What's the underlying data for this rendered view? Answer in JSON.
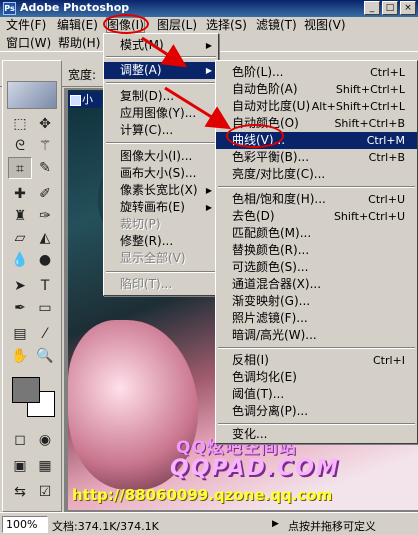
{
  "window": {
    "title": "Adobe Photoshop",
    "buttons": [
      "_",
      "□",
      "×"
    ]
  },
  "menubar": {
    "row1": [
      "文件(F)",
      "编辑(E)",
      "图像(I)",
      "图层(L)",
      "选择(S)",
      "滤镜(T)",
      "视图(V)"
    ],
    "row2": [
      "窗口(W)",
      "帮助(H)"
    ]
  },
  "options": {
    "width_label": "宽度:"
  },
  "document": {
    "tab_title": "小"
  },
  "image_menu": {
    "items": [
      {
        "label": "模式(M)",
        "submenu": true
      },
      {
        "label": "调整(A)",
        "submenu": true
      },
      {
        "label": "复制(D)..."
      },
      {
        "label": "应用图像(Y)..."
      },
      {
        "label": "计算(C)..."
      },
      {
        "label": "图像大小(I)..."
      },
      {
        "label": "画布大小(S)..."
      },
      {
        "label": "像素长宽比(X)",
        "submenu": true
      },
      {
        "label": "旋转画布(E)",
        "submenu": true
      },
      {
        "label": "裁切(P)",
        "disabled": true
      },
      {
        "label": "修整(R)..."
      },
      {
        "label": "显示全部(V)",
        "disabled": true
      },
      {
        "label": "陷印(T)...",
        "disabled": true
      }
    ]
  },
  "adjust_menu": {
    "items": [
      {
        "label": "色阶(L)...",
        "shortcut": "Ctrl+L"
      },
      {
        "label": "自动色阶(A)",
        "shortcut": "Shift+Ctrl+L"
      },
      {
        "label": "自动对比度(U)",
        "shortcut": "Alt+Shift+Ctrl+L"
      },
      {
        "label": "自动颜色(O)",
        "shortcut": "Shift+Ctrl+B"
      },
      {
        "label": "曲线(V)...",
        "shortcut": "Ctrl+M"
      },
      {
        "label": "色彩平衡(B)...",
        "shortcut": "Ctrl+B"
      },
      {
        "label": "亮度/对比度(C)..."
      },
      {
        "label": "色相/饱和度(H)...",
        "shortcut": "Ctrl+U"
      },
      {
        "label": "去色(D)",
        "shortcut": "Shift+Ctrl+U"
      },
      {
        "label": "匹配颜色(M)..."
      },
      {
        "label": "替换颜色(R)..."
      },
      {
        "label": "可选颜色(S)..."
      },
      {
        "label": "通道混合器(X)..."
      },
      {
        "label": "渐变映射(G)..."
      },
      {
        "label": "照片滤镜(F)..."
      },
      {
        "label": "暗调/高光(W)..."
      },
      {
        "label": "反相(I)",
        "shortcut": "Ctrl+I"
      },
      {
        "label": "色调均化(E)"
      },
      {
        "label": "阈值(T)..."
      },
      {
        "label": "色调分离(P)..."
      },
      {
        "label": "变化..."
      }
    ]
  },
  "watermark": {
    "line1": "QQ炫吧空间站",
    "line2": "QQPAD.COM",
    "line3": "http://88060099.qzone.qq.com"
  },
  "status": {
    "zoom": "100%",
    "doc_size": "文档:374.1K/374.1K",
    "hint": "点按并拖移可定义"
  },
  "colors": {
    "highlight": "#0a246a",
    "annotation": "#e00000",
    "chrome": "#d4d0c8"
  }
}
